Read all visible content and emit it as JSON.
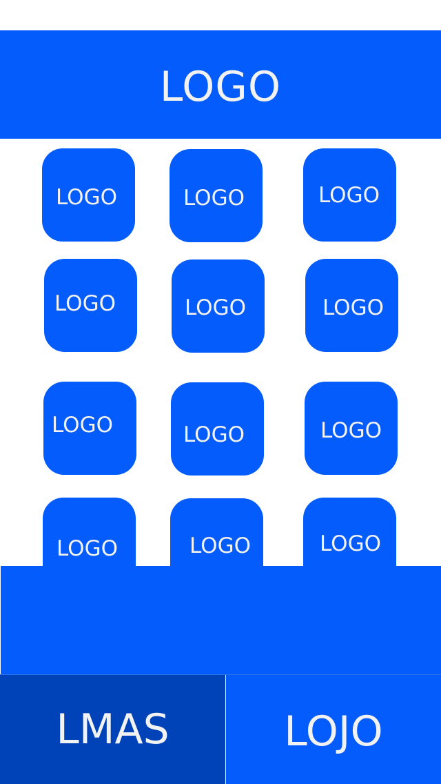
{
  "header": {
    "logo_text": "LOGO"
  },
  "grid": {
    "tiles": [
      {
        "label": "LOGO"
      },
      {
        "label": "LOGO"
      },
      {
        "label": "LOGO"
      },
      {
        "label": "LOGO"
      },
      {
        "label": "LOGO"
      },
      {
        "label": "LOGO"
      },
      {
        "label": "LOGO"
      },
      {
        "label": "LOGO"
      },
      {
        "label": "LOGO"
      },
      {
        "label": "LOGO"
      },
      {
        "label": "LOGO"
      },
      {
        "label": "LOGO"
      }
    ]
  },
  "bottom_bar": {
    "left_label": "LMAS",
    "right_label": "LOJO"
  },
  "colors": {
    "primary_blue": "#045cfc",
    "dark_blue": "#0042b8",
    "label_text": "#f2f2f2",
    "background": "#ffffff"
  }
}
